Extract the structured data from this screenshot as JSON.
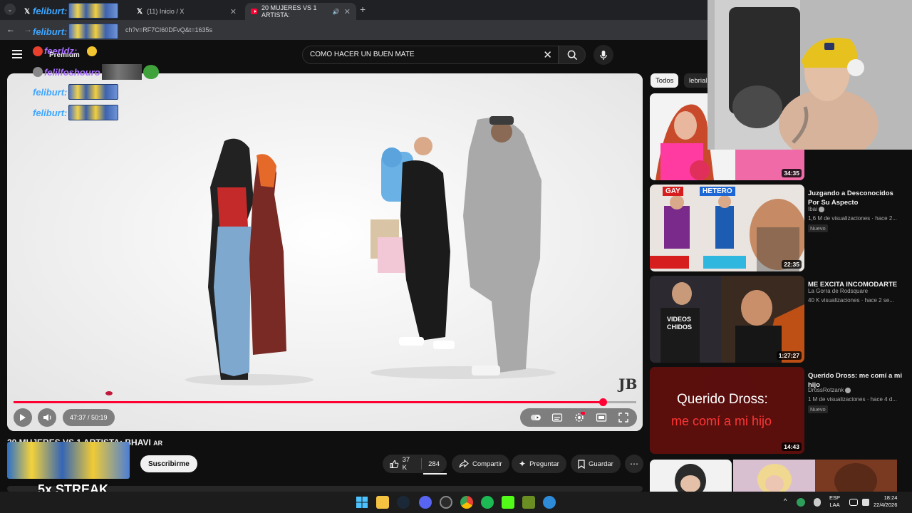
{
  "browser": {
    "tabs": [
      {
        "title": "",
        "icon": "x-logo-icon"
      },
      {
        "title": "(11) Inicio / X",
        "icon": "x-logo-icon"
      },
      {
        "title": "20 MUJERES VS 1 ARTISTA:",
        "icon": "youtube-icon",
        "active": true
      }
    ],
    "url": "ch?v=RF7CI60DFvQ&t=1635s"
  },
  "youtube": {
    "premium_label": "Premium",
    "search_value": "COMO HACER UN BUEN MATE",
    "video": {
      "title": "20 MUJERES VS 1 ARTISTA: BHAVI",
      "title_suffix": "AR",
      "time_display": "47:37 / 50:19",
      "progress": 0.946
    },
    "actions": {
      "subscribe": "Suscribirme",
      "likes": "37 K",
      "dislikes": "284",
      "share": "Compartir",
      "ask": "Preguntar",
      "save": "Guardar"
    },
    "chips": [
      "Todos",
      "lebrial"
    ],
    "recommendations": [
      {
        "title": "",
        "channel": "",
        "meta": "",
        "duration": "34:35",
        "badge": ""
      },
      {
        "title": "Juzgando a Desconocidos Por Su Aspecto",
        "channel": "Ibai",
        "meta": "1,6 M de visualizaciones · hace 2...",
        "duration": "22:35",
        "badge": "Nuevo",
        "thumb_labels": [
          "GAY",
          "HETERO"
        ]
      },
      {
        "title": "ME EXCITA INCOMODARTE",
        "channel": "La Gorra de Rodsquare",
        "meta": "40 K visualizaciones · hace 2 se...",
        "duration": "1:27:27",
        "badge": "",
        "thumb_labels": [
          "VIDEOS",
          "CHIDOS"
        ]
      },
      {
        "title": "Querido Dross: me comí a mi hijo",
        "channel": "DrossRotzank",
        "meta": "1 M de visualizaciones · hace 4 d...",
        "duration": "14:43",
        "badge": "Nuevo",
        "thumb_labels": [
          "Querido Dross:",
          "me comí a mi hijo"
        ]
      }
    ]
  },
  "overlay": {
    "chat": [
      {
        "user": "feliburt:"
      },
      {
        "user": "feliburt:"
      },
      {
        "user": "feerldz:"
      },
      {
        "user": "felilfoshouro"
      },
      {
        "user": "feliburt:"
      },
      {
        "user": "feliburt:"
      }
    ],
    "streak": "5x STREAK"
  },
  "taskbar": {
    "lang": [
      "ESP",
      "LAA"
    ],
    "clock": [
      "18:24",
      "22/4/2026"
    ]
  },
  "colors": {
    "accent": "#ff0033",
    "link": "#3ea6ff"
  }
}
